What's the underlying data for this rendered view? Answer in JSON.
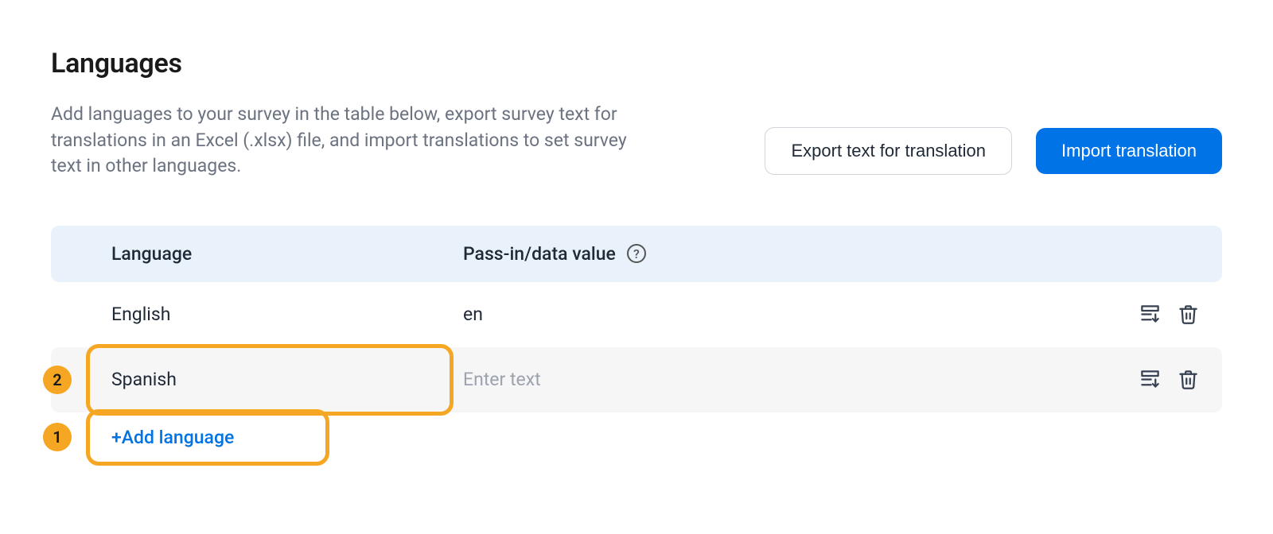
{
  "header": {
    "title": "Languages",
    "description": "Add languages to your survey in the table below, export survey text for translations in an Excel (.xlsx) file, and import translations to set survey text in other languages."
  },
  "actions": {
    "export_label": "Export text for translation",
    "import_label": "Import translation"
  },
  "table": {
    "columns": {
      "language": "Language",
      "value": "Pass-in/data value"
    },
    "rows": [
      {
        "language": "English",
        "value": "en",
        "placeholder": "Enter text",
        "highlighted": false
      },
      {
        "language": "Spanish",
        "value": "",
        "placeholder": "Enter text",
        "highlighted": true
      }
    ],
    "add_label": "+Add language"
  },
  "callouts": {
    "row2_badge": "2",
    "add_badge": "1"
  }
}
